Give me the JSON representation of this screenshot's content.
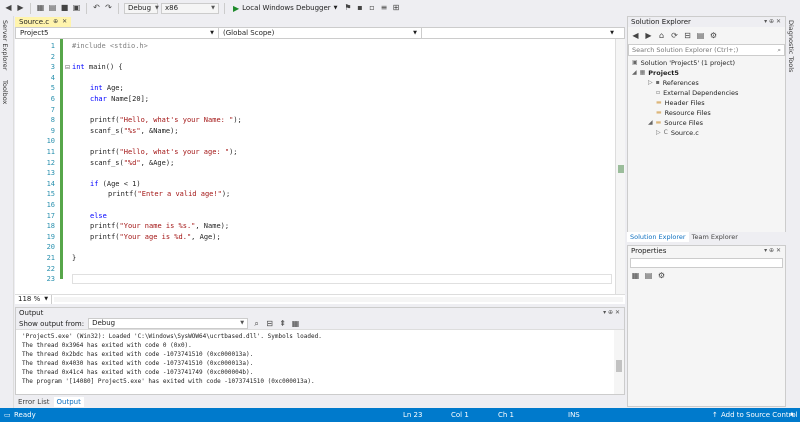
{
  "toolbar": {
    "config": "Debug",
    "platform": "x86",
    "debugger_label": "Local Windows Debugger"
  },
  "left_sidebar": {
    "server_explorer": "Server Explorer",
    "toolbox": "Toolbox"
  },
  "right_sidebar": {
    "diagnostic_tools": "Diagnostic Tools"
  },
  "editor": {
    "tab_title": "Source.c",
    "project_combo": "Project5",
    "scope_combo": "(Global Scope)",
    "line_numbers": [
      "1",
      "2",
      "3",
      "4",
      "5",
      "6",
      "7",
      "8",
      "9",
      "10",
      "11",
      "12",
      "13",
      "14",
      "15",
      "16",
      "17",
      "18",
      "19",
      "20",
      "21",
      "22",
      "23"
    ],
    "zoom": "118 %"
  },
  "code": {
    "l1_pp": "#include <stdio.h>",
    "l3_kw": "int",
    "l3_rest": " main() {",
    "l5_kw": "int",
    "l5_rest": " Age;",
    "l6_kw": "char",
    "l6_rest": " Name[20];",
    "l8_a": "printf(",
    "l8_str": "\"Hello, what's your Name: \"",
    "l8_b": ");",
    "l9_a": "scanf_s(",
    "l9_str": "\"%s\"",
    "l9_b": ", &Name);",
    "l11_a": "printf(",
    "l11_str": "\"Hello, what's your age: \"",
    "l11_b": ");",
    "l12_a": "scanf_s(",
    "l12_str": "\"%d\"",
    "l12_b": ", &Age);",
    "l14_kw": "if",
    "l14_rest": " (Age < 1)",
    "l15_a": "printf(",
    "l15_str": "\"Enter a valid age!\"",
    "l15_b": ");",
    "l17_kw": "else",
    "l18_a": "printf(",
    "l18_str": "\"Your name is %s.\"",
    "l18_b": ", Name);",
    "l19_a": "printf(",
    "l19_str": "\"Your age is %d.\"",
    "l19_b": ", Age);",
    "l21": "}"
  },
  "output": {
    "title": "Output",
    "show_from_label": "Show output from:",
    "source": "Debug",
    "lines": [
      "'Project5.exe' (Win32): Loaded 'C:\\Windows\\SysWOW64\\ucrtbased.dll'. Symbols loaded.",
      "The thread 0x3964 has exited with code 0 (0x0).",
      "The thread 0x2bdc has exited with code -1073741510 (0xc000013a).",
      "The thread 0x4030 has exited with code -1073741510 (0xc000013a).",
      "The thread 0x41c4 has exited with code -1073741749 (0xc000004b).",
      "The program '[14080] Project5.exe' has exited with code -1073741510 (0xc000013a)."
    ]
  },
  "bottom_tabs": [
    "Error List",
    "Output"
  ],
  "solution_explorer": {
    "title": "Solution Explorer",
    "search_placeholder": "Search Solution Explorer (Ctrl+;)",
    "nodes": {
      "solution": "Solution 'Project5' (1 project)",
      "project": "Project5",
      "references": "References",
      "external": "External Dependencies",
      "header": "Header Files",
      "resource": "Resource Files",
      "source": "Source Files",
      "source_c": "Source.c"
    },
    "tabs": [
      "Solution Explorer",
      "Team Explorer"
    ]
  },
  "properties": {
    "title": "Properties"
  },
  "status": {
    "ready": "Ready",
    "ln": "Ln 23",
    "col": "Col 1",
    "ch": "Ch 1",
    "ins": "INS",
    "source_control": "Add to Source Control"
  },
  "colors": {
    "status_bar": "#007acc",
    "keyword": "#0000ff",
    "string": "#a31515",
    "line_number": "#2b91af",
    "tab_active": "#fff4ad"
  }
}
